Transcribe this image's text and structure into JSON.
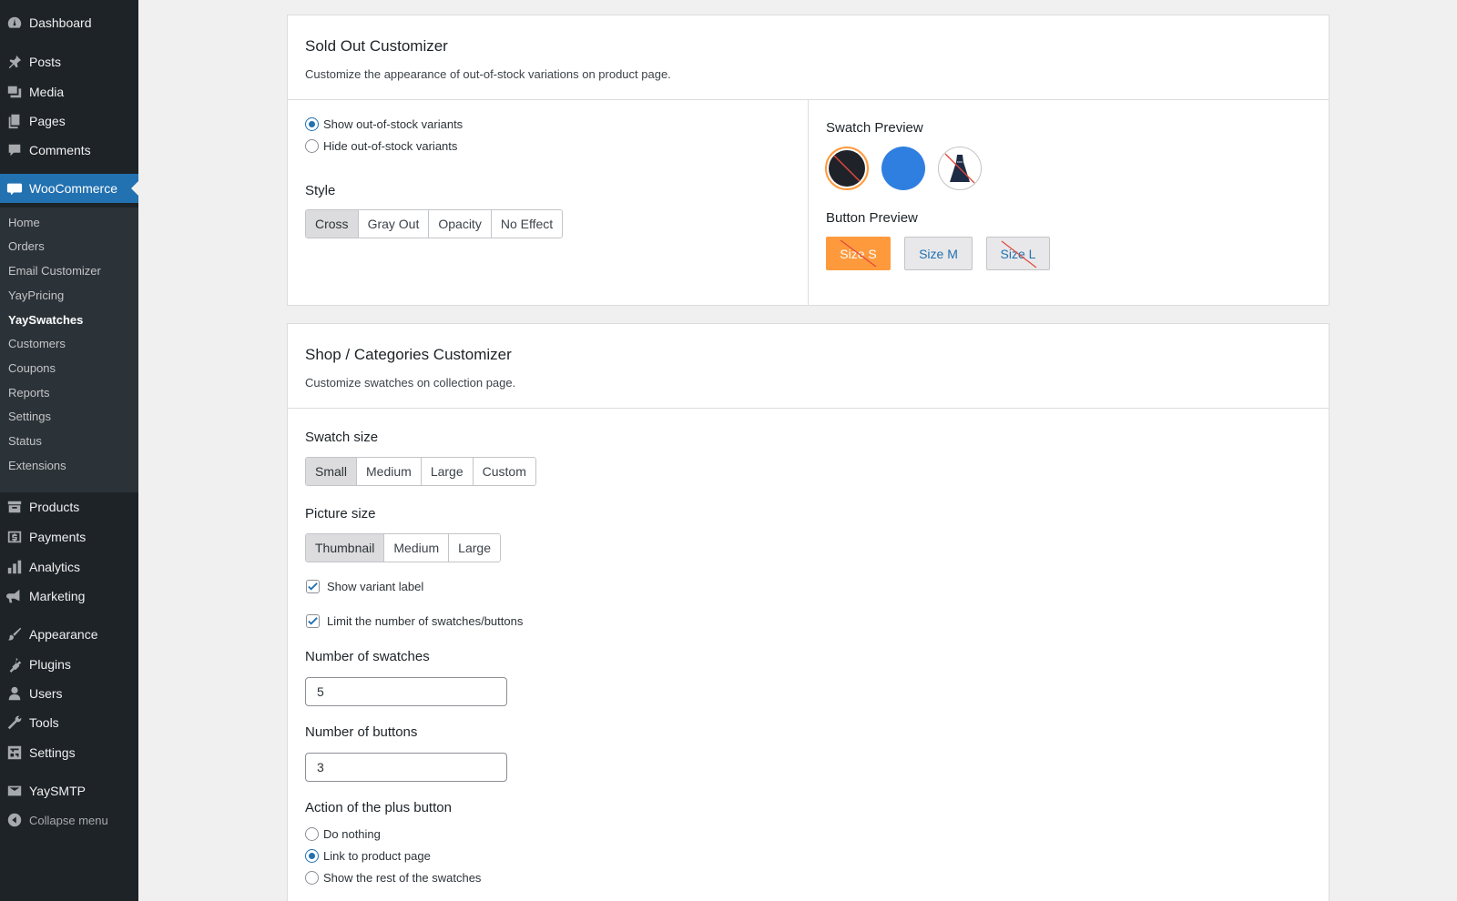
{
  "sidebar": {
    "top_items": [
      {
        "label": "Dashboard",
        "icon": "dashboard-icon"
      },
      {
        "label": "Posts",
        "icon": "pin-icon"
      },
      {
        "label": "Media",
        "icon": "media-icon"
      },
      {
        "label": "Pages",
        "icon": "pages-icon"
      },
      {
        "label": "Comments",
        "icon": "comment-icon"
      },
      {
        "label": "WooCommerce",
        "icon": "woo-icon"
      }
    ],
    "submenu": [
      "Home",
      "Orders",
      "Email Customizer",
      "YayPricing",
      "YaySwatches",
      "Customers",
      "Coupons",
      "Reports",
      "Settings",
      "Status",
      "Extensions"
    ],
    "current_submenu": "YaySwatches",
    "bottom_items": [
      {
        "label": "Products",
        "icon": "archive-icon"
      },
      {
        "label": "Payments",
        "icon": "dollar-icon"
      },
      {
        "label": "Analytics",
        "icon": "bar-chart-icon"
      },
      {
        "label": "Marketing",
        "icon": "megaphone-icon"
      },
      {
        "label": "Appearance",
        "icon": "paintbrush-icon"
      },
      {
        "label": "Plugins",
        "icon": "plugin-icon"
      },
      {
        "label": "Users",
        "icon": "user-icon"
      },
      {
        "label": "Tools",
        "icon": "wrench-icon"
      },
      {
        "label": "Settings",
        "icon": "settings-icon"
      },
      {
        "label": "YaySMTP",
        "icon": "email-icon"
      }
    ],
    "collapse_label": "Collapse menu"
  },
  "sold_out": {
    "title": "Sold Out Customizer",
    "description": "Customize the appearance of out-of-stock variations on product page.",
    "visibility_options": [
      "Show out-of-stock variants",
      "Hide out-of-stock variants"
    ],
    "visibility_selected": "Show out-of-stock variants",
    "style_label": "Style",
    "style_options": [
      "Cross",
      "Gray Out",
      "Opacity",
      "No Effect"
    ],
    "style_selected": "Cross",
    "swatch_preview_label": "Swatch Preview",
    "button_preview_label": "Button Preview",
    "preview_buttons": [
      "Size S",
      "Size M",
      "Size L"
    ],
    "colors": {
      "accent": "#ff9a3c",
      "swatch_dark": "#1f2229",
      "swatch_blue": "#2f7fe0",
      "cross_line": "#e0483c",
      "button_text": "#2271b1"
    }
  },
  "shop": {
    "title": "Shop / Categories Customizer",
    "description": "Customize swatches on collection page.",
    "swatch_size_label": "Swatch size",
    "swatch_size_options": [
      "Small",
      "Medium",
      "Large",
      "Custom"
    ],
    "swatch_size_selected": "Small",
    "picture_size_label": "Picture size",
    "picture_size_options": [
      "Thumbnail",
      "Medium",
      "Large"
    ],
    "picture_size_selected": "Thumbnail",
    "show_variant_label": "Show variant label",
    "limit_label": "Limit the number of swatches/buttons",
    "num_swatches_label": "Number of swatches",
    "num_swatches_value": "5",
    "num_buttons_label": "Number of buttons",
    "num_buttons_value": "3",
    "plus_action_label": "Action of the plus button",
    "plus_action_options": [
      "Do nothing",
      "Link to product page",
      "Show the rest of the swatches"
    ],
    "plus_action_selected": "Link to product page"
  }
}
